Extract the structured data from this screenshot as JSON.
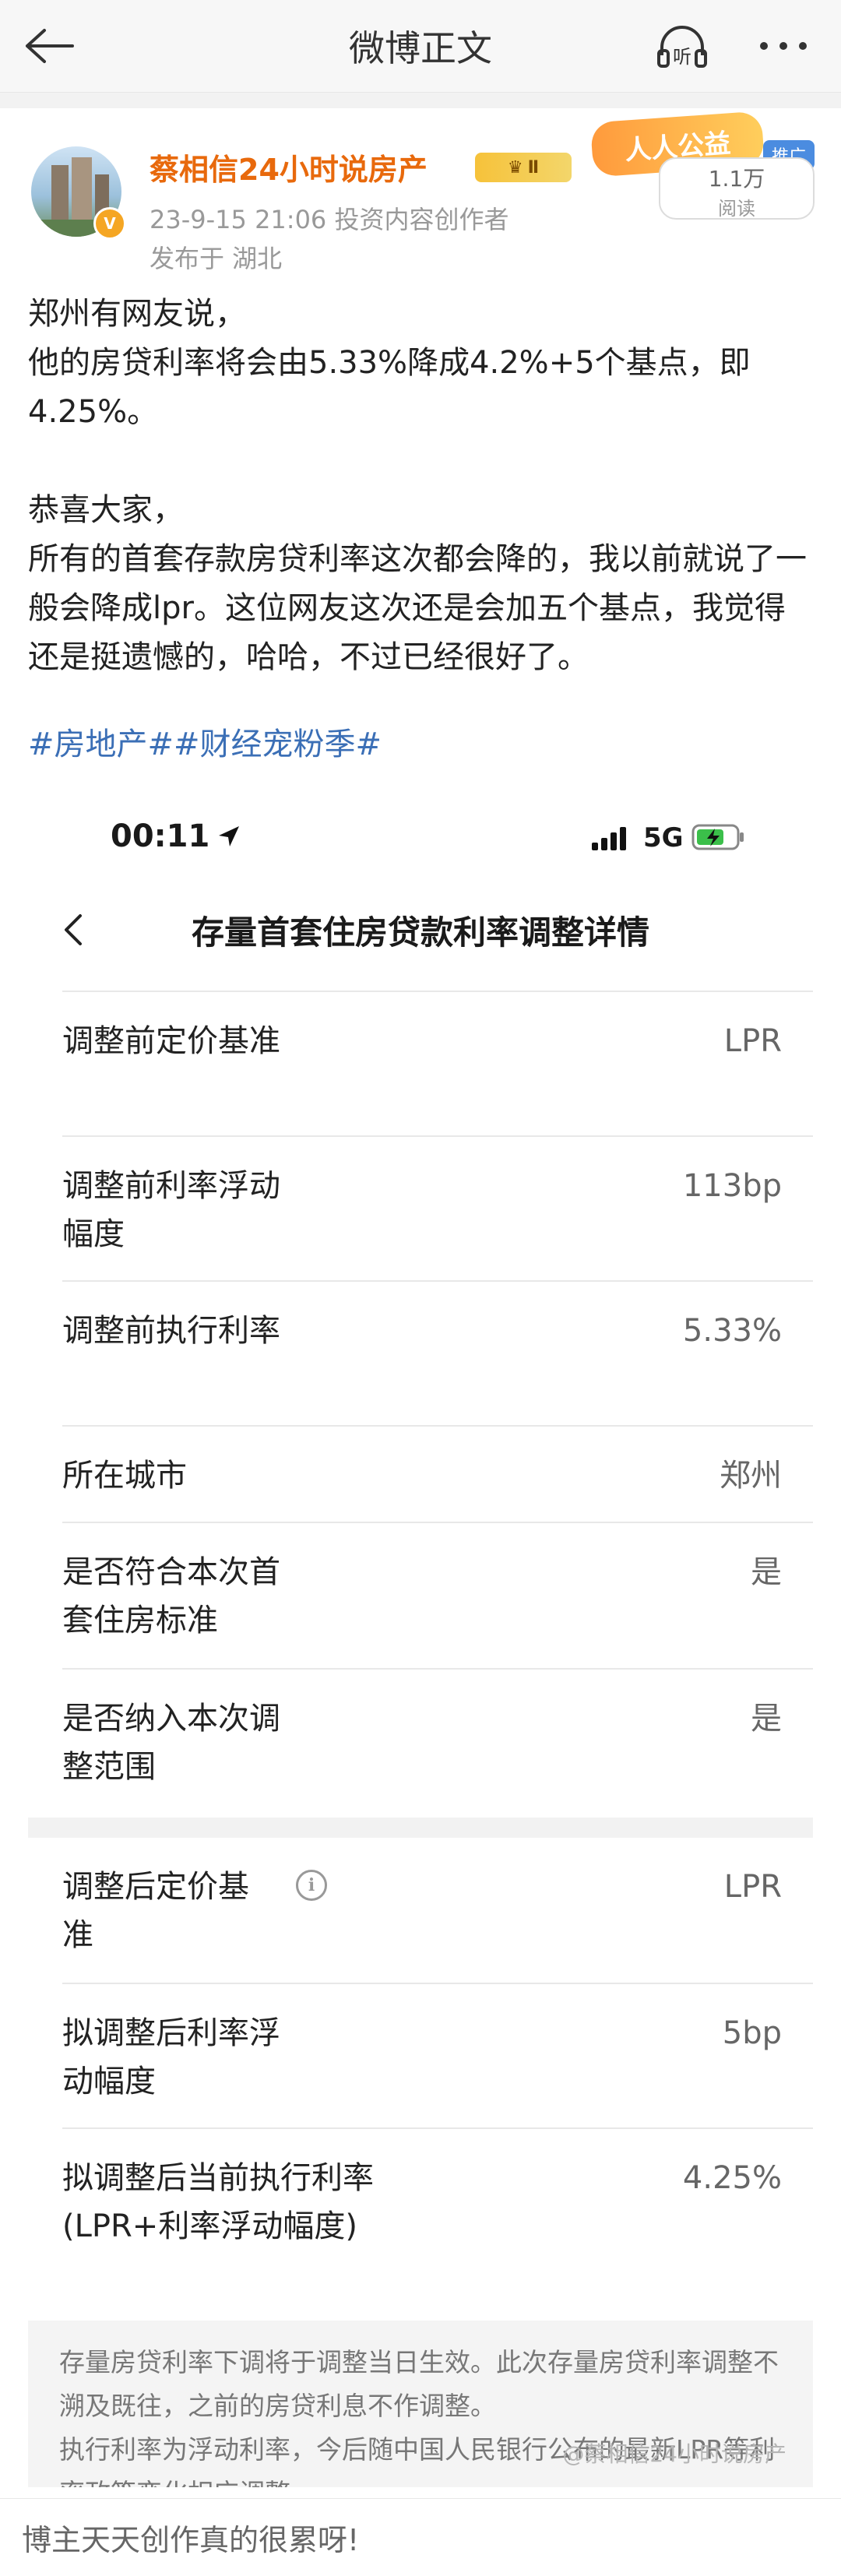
{
  "nav": {
    "title": "微博正文",
    "listen_label": "听"
  },
  "post": {
    "author": "蔡相信24小时说房产",
    "level_badge": "Ⅱ",
    "ad_banner": "人人公益",
    "promo_tag": "推广",
    "read_count": "1.1万",
    "read_label": "阅读",
    "timestamp_role": "23-9-15 21:06  投资内容创作者",
    "location": "发布于 湖北",
    "body": [
      "郑州有网友说，",
      "他的房贷利率将会由5.33%降成4.2%+5个基点，即4.25%。",
      "",
      "恭喜大家，",
      "所有的首套存款房贷利率这次都会降的，我以前就说了一般会降成lpr。这位网友这次还是会加五个基点，我觉得还是挺遗憾的，哈哈，不过已经很好了。"
    ],
    "hashtags": "#房地产##财经宠粉季#"
  },
  "screenshot": {
    "status_time": "00:11",
    "network": "5G",
    "header_title": "存量首套住房贷款利率调整详情",
    "rows_before": [
      {
        "label": "调整前定价基准",
        "value": "LPR"
      },
      {
        "label": "调整前利率浮动幅度",
        "value": "113bp"
      },
      {
        "label": "调整前执行利率",
        "value": "5.33%"
      },
      {
        "label": "所在城市",
        "value": "郑州"
      },
      {
        "label": "是否符合本次首套住房标准",
        "value": "是"
      },
      {
        "label": "是否纳入本次调整范围",
        "value": "是"
      }
    ],
    "rows_after": [
      {
        "label": "调整后定价基准",
        "value": "LPR"
      },
      {
        "label": "拟调整后利率浮动幅度",
        "value": "5bp"
      },
      {
        "label": "拟调整后当前执行利率(LPR+利率浮动幅度)",
        "value": "4.25%"
      }
    ],
    "notice": [
      "存量房贷利率下调将于调整当日生效。此次存量房贷利率调整不溯及既往，之前的房贷利息不作调整。",
      "执行利率为浮动利率，今后随中国人民银行公布的最新LPR等利率政策变化相应调整。"
    ],
    "watermark": "@蔡相信24小时说房产"
  },
  "comment_bar": {
    "placeholder": "博主天天创作真的很累呀!"
  },
  "colors": {
    "author": "#e8690c",
    "hashtag": "#3b6fb6",
    "read_border": "#dcdcdc"
  }
}
